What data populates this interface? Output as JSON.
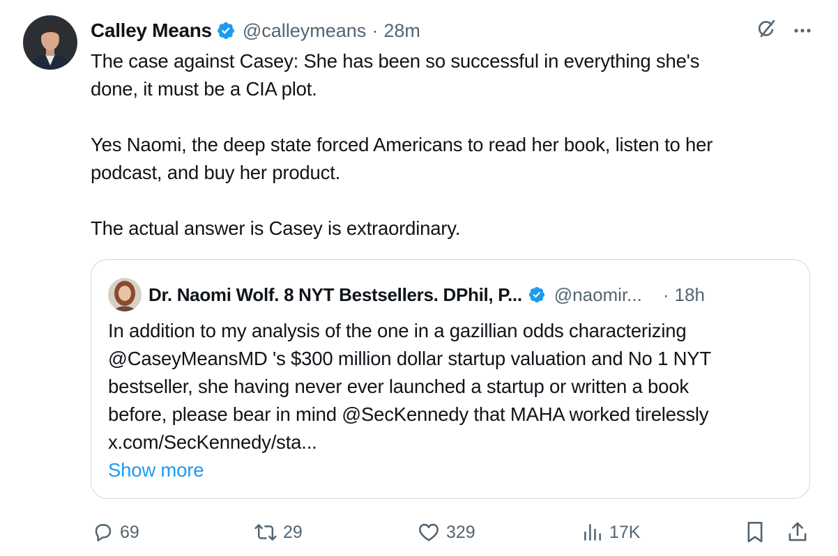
{
  "post": {
    "author": {
      "name": "Calley Means",
      "handle": "@calleymeans",
      "time": "28m",
      "separator": "·"
    },
    "text": {
      "line1": "The case against Casey: She has been so successful in everything she's",
      "line2": "done, it must be a CIA plot.",
      "line3": "Yes Naomi, the deep state forced Americans to read her book, listen to her",
      "line4": "podcast, and buy her product.",
      "line5": "The actual answer is Casey is extraordinary."
    },
    "icons": {
      "grok": "grok-icon",
      "more": "more-icon"
    }
  },
  "quote": {
    "author": {
      "name": "Dr. Naomi Wolf. 8 NYT Bestsellers. DPhil, P...",
      "handle": "@naomir...",
      "time": "18h",
      "separator": "·"
    },
    "text": {
      "line1": "In addition to my analysis of the one in a gazillian odds characterizing",
      "line2": "@CaseyMeansMD 's $300 million dollar startup valuation and No 1 NYT",
      "line3": "bestseller, she having  never ever launched a startup or written a book",
      "line4": "before, please bear in mind @SecKennedy that MAHA worked tirelessly",
      "line5": "x.com/SecKennedy/sta..."
    },
    "show_more": "Show more"
  },
  "actions": {
    "replies": "69",
    "reposts": "29",
    "likes": "329",
    "views": "17K"
  },
  "colors": {
    "text": "#0f1419",
    "secondary": "#536471",
    "accent": "#1d9bf0",
    "border": "#cfd9de"
  }
}
